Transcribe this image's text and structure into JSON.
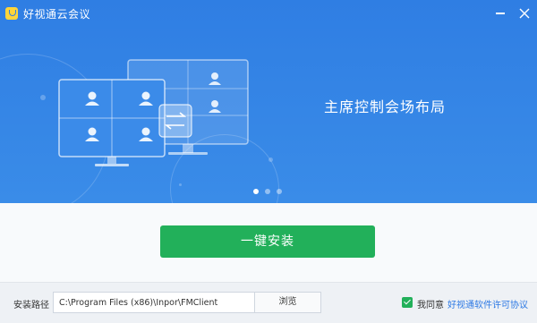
{
  "window": {
    "title": "好视通云会议",
    "minimize_icon": "minimize-icon",
    "close_icon": "close-icon"
  },
  "banner": {
    "slide_title": "主席控制会场布局",
    "illustration": "monitors-with-swap-icon",
    "carousel": {
      "count": 3,
      "active_index": 0
    }
  },
  "install": {
    "button_label": "一键安装"
  },
  "path": {
    "label": "安装路径",
    "value": "C:\\Program Files (x86)\\Inpor\\FMClient",
    "browse_label": "浏览"
  },
  "agreement": {
    "checked": true,
    "label": "我同意",
    "link_text": "好视通软件许可协议"
  },
  "colors": {
    "banner": "#2f7ee3",
    "install_button": "#22b05a",
    "link": "#2b78e4"
  }
}
